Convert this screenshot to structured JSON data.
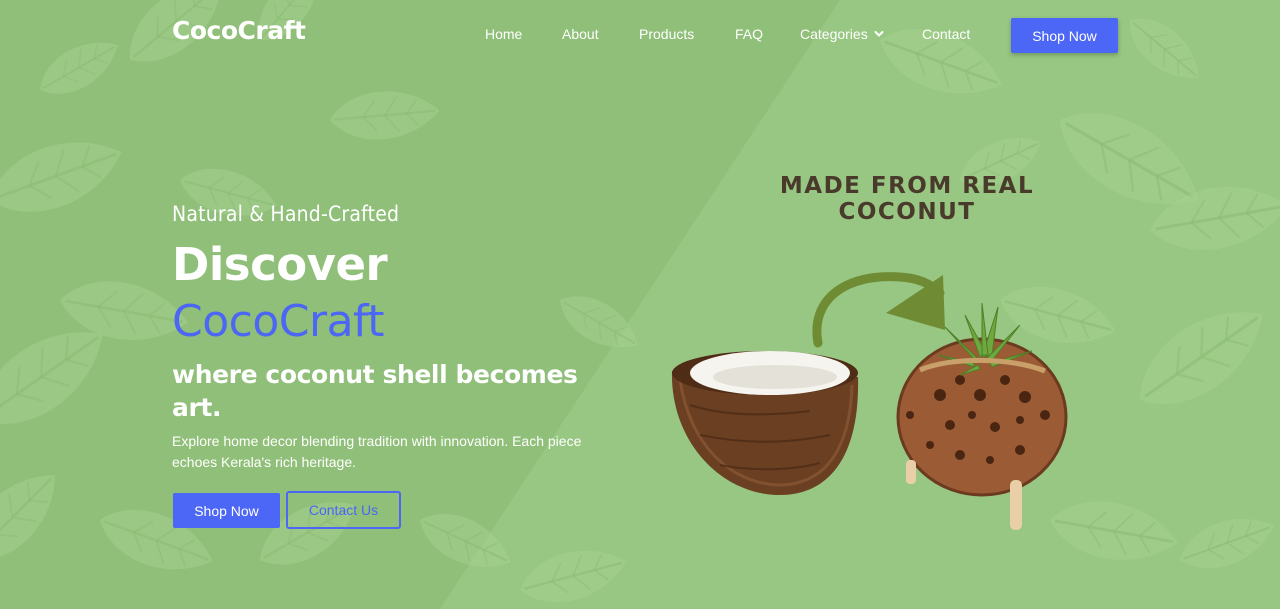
{
  "brand": {
    "name": "CocoCraft"
  },
  "nav": {
    "items": [
      {
        "label": "Home"
      },
      {
        "label": "About"
      },
      {
        "label": "Products"
      },
      {
        "label": "FAQ"
      },
      {
        "label": "Categories",
        "icon": "chevron-down-icon"
      },
      {
        "label": "Contact"
      }
    ],
    "cta_label": "Shop Now"
  },
  "hero": {
    "tagline": "Natural & Hand-Crafted",
    "title": "Discover",
    "brand_highlight": "CocoCraft",
    "subtitle": "where coconut shell becomes art.",
    "description": "Explore home decor blending tradition with innovation. Each piece echoes Kerala's rich heritage.",
    "primary_button": "Shop Now",
    "secondary_button": "Contact Us"
  },
  "hero_image": {
    "caption_line1": "MADE FROM REAL",
    "caption_line2": "COCONUT"
  },
  "colors": {
    "background": "#8fbf78",
    "accent": "#4c66f5",
    "caption": "#4a3a2c"
  }
}
